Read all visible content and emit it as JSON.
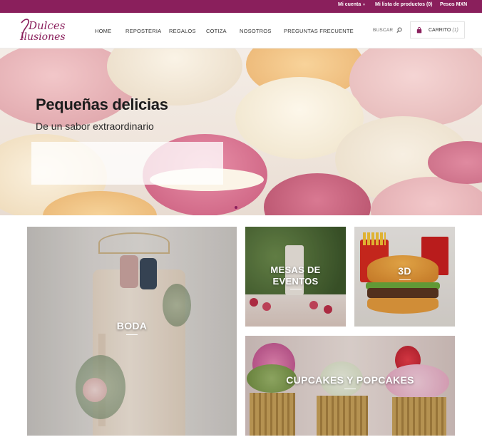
{
  "topbar": {
    "account": "Mi cuenta",
    "wishlist": "Mi lista de productos (0)",
    "currency": "Pesos MXN"
  },
  "brand": {
    "logo_line1": "Dulces",
    "logo_line2": "Ilusiones"
  },
  "nav": {
    "items": [
      {
        "label": "HOME"
      },
      {
        "label": "REPOSTERIA"
      },
      {
        "label": "REGALOS"
      },
      {
        "label": "COTIZA"
      },
      {
        "label": "NOSOTROS"
      },
      {
        "label": "PREGUNTAS FRECUENTE"
      }
    ]
  },
  "search": {
    "label": "BUSCAR"
  },
  "cart": {
    "label": "CARRITO",
    "count": "(1)"
  },
  "hero": {
    "title": "Pequeñas delicias",
    "subtitle": "De un sabor extraordinario"
  },
  "categories": [
    {
      "label": "BODA"
    },
    {
      "label": "MESAS DE EVENTOS"
    },
    {
      "label": "3D"
    },
    {
      "label": "CUPCAKES Y POPCAKES"
    }
  ],
  "colors": {
    "brand": "#8a1f5c",
    "text": "#333333"
  },
  "icons": {
    "search": "search-icon",
    "cart": "cart-icon",
    "caret": "chevron-down-icon"
  }
}
